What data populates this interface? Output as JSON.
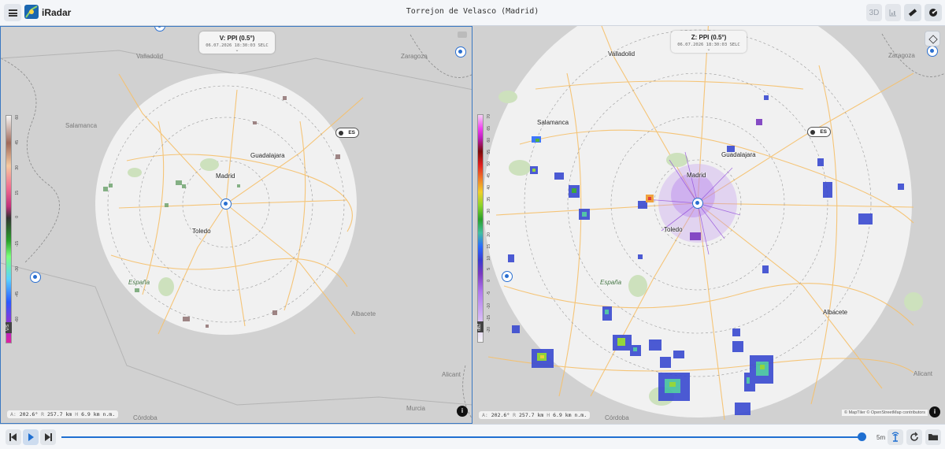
{
  "header": {
    "app_title": "iRadar",
    "window_title": "Torrejon de Velasco (Madrid)",
    "btn_3d": "3D"
  },
  "left_panel": {
    "ppi_title": "V: PPI (0.5°)",
    "ppi_time": "06.07.2026 18:30:03 SELC",
    "scale_name": "V/S",
    "scale_ticks": [
      "60",
      "45",
      "30",
      "15",
      "0",
      "-15",
      "-30",
      "-45",
      "-60"
    ],
    "es_label": "ES",
    "coords": {
      "a_label": "A:",
      "a": "202.6°",
      "r_label": "R",
      "r": "257.7 km",
      "h_label": "H",
      "h": "6.9 km n.m."
    },
    "places": {
      "valladolid": "Valladolid",
      "zaragoza": "Zaragoza",
      "salamanca": "Salamanca",
      "madrid": "Madrid",
      "guadalajara": "Guadalajara",
      "toledo": "Toledo",
      "espana": "España",
      "albacete": "Albacete",
      "alicante": "Alicant",
      "murcia": "Murcia",
      "cordoba": "Córdoba"
    }
  },
  "right_panel": {
    "ppi_title": "Z: PPI (0.5°)",
    "ppi_time": "06.07.2026 18:30:03 SELC",
    "scale_name": "dBZ",
    "scale_ticks": [
      "70",
      "65",
      "60",
      "55",
      "50",
      "45",
      "40",
      "35",
      "30",
      "25",
      "20",
      "15",
      "10",
      "5",
      "0",
      "-5",
      "-10",
      "-15",
      "-20"
    ],
    "es_label": "ES",
    "coords": {
      "a_label": "A:",
      "a": "202.6°",
      "r_label": "R",
      "r": "257.7 km",
      "h_label": "H",
      "h": "6.9 km n.m."
    },
    "attribution": "© MapTiler © OpenStreetMap contributors",
    "places": {
      "valladolid": "Valladolid",
      "zaragoza": "Zaragoza",
      "salamanca": "Salamanca",
      "madrid": "Madrid",
      "guadalajara": "Guadalajara",
      "toledo": "Toledo",
      "espana": "España",
      "albacete": "Albacete",
      "alicante": "Alicant",
      "cordoba": "Córdoba"
    }
  },
  "bottom": {
    "step_label": "5m"
  },
  "colors": {
    "accent": "#1f6fd1",
    "map_base": "#d1d1d1",
    "radar_disc": "#f1f1f1",
    "roads": "#f6c06a"
  }
}
